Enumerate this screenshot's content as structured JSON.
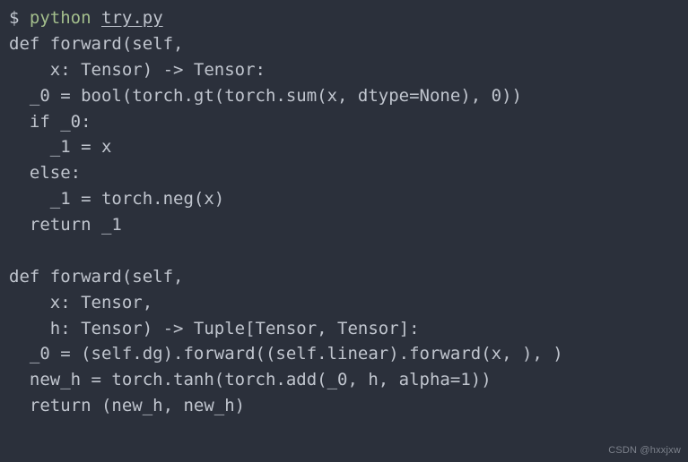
{
  "prompt_symbol": "$",
  "command": {
    "interpreter": "python",
    "file": "try.py"
  },
  "code_block1": "def forward(self,\n    x: Tensor) -> Tensor:\n  _0 = bool(torch.gt(torch.sum(x, dtype=None), 0))\n  if _0:\n    _1 = x\n  else:\n    _1 = torch.neg(x)\n  return _1",
  "code_block2": "def forward(self,\n    x: Tensor,\n    h: Tensor) -> Tuple[Tensor, Tensor]:\n  _0 = (self.dg).forward((self.linear).forward(x, ), )\n  new_h = torch.tanh(torch.add(_0, h, alpha=1))\n  return (new_h, new_h)",
  "watermark": "CSDN @hxxjxw"
}
